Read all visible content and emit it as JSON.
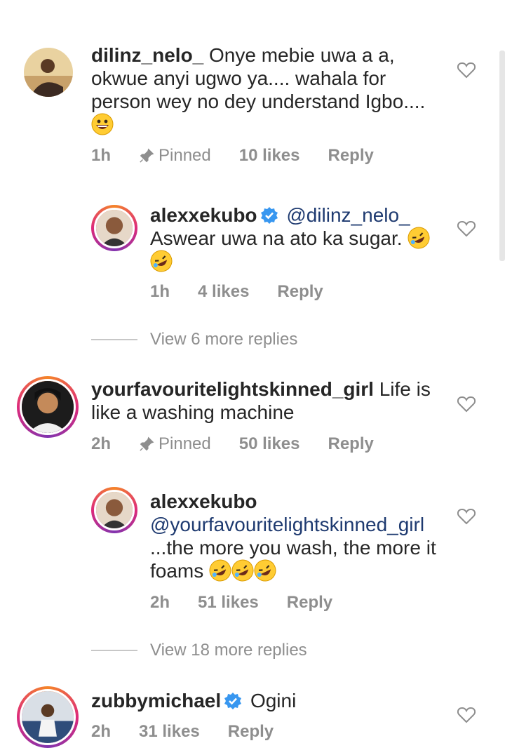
{
  "comments": [
    {
      "username": "dilinz_nelo_",
      "text": "Onye mebie uwa a a, okwue anyi ugwo ya.... wahala for person wey no dey understand Igbo....",
      "time": "1h",
      "pinned_label": "Pinned",
      "likes": "10 likes",
      "reply": "Reply",
      "emoji_icon": "grinning-face-emoji"
    },
    {
      "username": "alexxekubo",
      "mention": "@dilinz_nelo_",
      "text": "Aswear uwa na ato ka sugar.",
      "time": "1h",
      "likes": "4 likes",
      "reply": "Reply",
      "emoji_icon": "rolling-laughing-emoji"
    },
    {
      "username": "yourfavouritelightskinned_girl",
      "text": "Life is like a washing machine",
      "time": "2h",
      "pinned_label": "Pinned",
      "likes": "50 likes",
      "reply": "Reply"
    },
    {
      "username": "alexxekubo",
      "mention": "@yourfavouritelightskinned_girl",
      "text": "...the more you wash, the more it foams",
      "time": "2h",
      "likes": "51 likes",
      "reply": "Reply",
      "emoji_icon": "rolling-laughing-emoji"
    },
    {
      "username": "zubbymichael",
      "text": "Ogini",
      "time": "2h",
      "likes": "31 likes",
      "reply": "Reply"
    }
  ],
  "view_more": [
    "View 6 more replies",
    "View 18 more replies"
  ],
  "colors": {
    "text": "#262626",
    "muted": "#8e8e8e",
    "mention": "#1e3a70",
    "verified": "#3897f0"
  }
}
